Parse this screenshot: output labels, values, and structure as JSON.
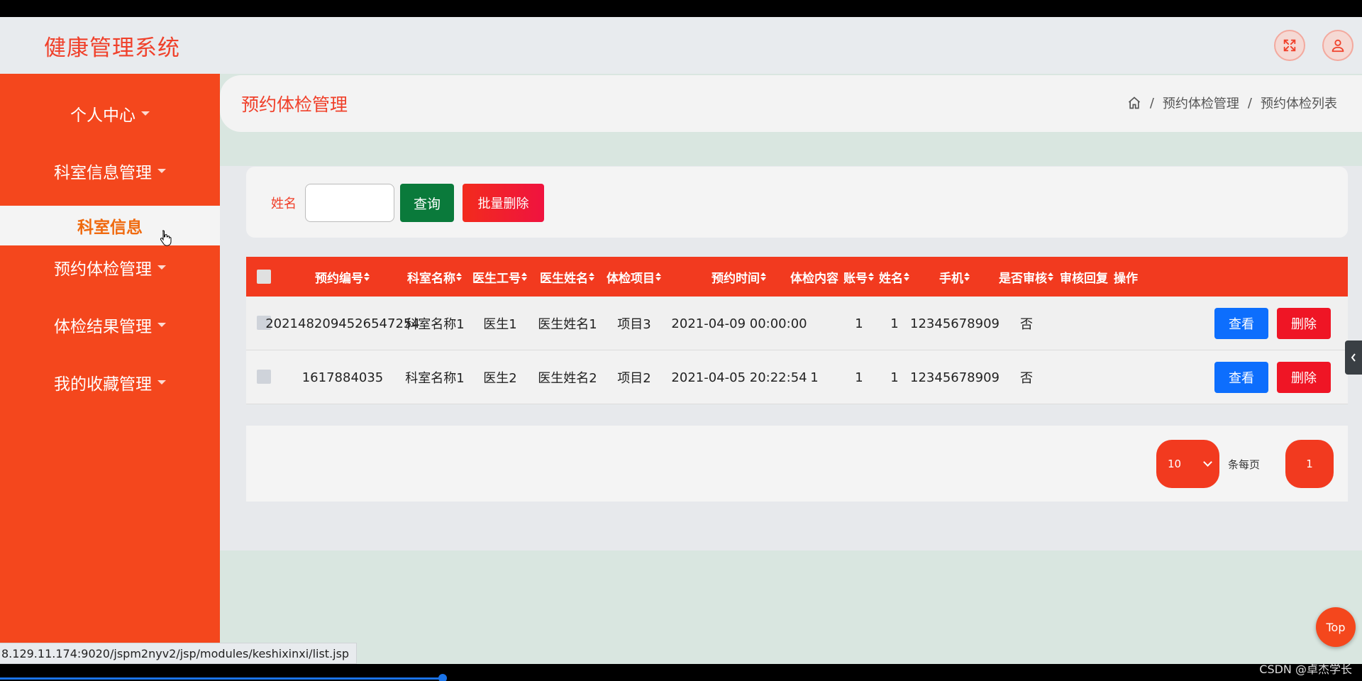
{
  "app": {
    "title": "健康管理系统"
  },
  "sidebar": {
    "items": [
      {
        "label": "个人中心"
      },
      {
        "label": "科室信息管理"
      },
      {
        "label": "预约体检管理"
      },
      {
        "label": "体检结果管理"
      },
      {
        "label": "我的收藏管理"
      }
    ],
    "active_sub": {
      "label": "科室信息"
    }
  },
  "page": {
    "title": "预约体检管理",
    "breadcrumb": [
      "预约体检管理",
      "预约体检列表"
    ],
    "separator": "/"
  },
  "search": {
    "label": "姓名",
    "value": "",
    "query_label": "查询",
    "batch_delete_label": "批量删除"
  },
  "table": {
    "columns": [
      "预约编号",
      "科室名称",
      "医生工号",
      "医生姓名",
      "体检项目",
      "预约时间",
      "体检内容",
      "账号",
      "姓名",
      "手机",
      "是否审核",
      "审核回复",
      "操作"
    ],
    "rows": [
      {
        "id": "2021482094526547254",
        "dept": "科室名称1",
        "doc_no": "医生1",
        "doc_name": "医生姓名1",
        "item": "项目3",
        "time": "2021-04-09 00:00:00",
        "content": "",
        "account": "1",
        "name": "1",
        "phone": "12345678909",
        "audited": "否",
        "reply": ""
      },
      {
        "id": "1617884035",
        "dept": "科室名称1",
        "doc_no": "医生2",
        "doc_name": "医生姓名2",
        "item": "项目2",
        "time": "2021-04-05 20:22:54",
        "content": "1",
        "account": "1",
        "name": "1",
        "phone": "12345678909",
        "audited": "否",
        "reply": ""
      }
    ],
    "view_label": "查看",
    "delete_label": "删除"
  },
  "pager": {
    "page_size": "10",
    "per_page_label": "条每页",
    "current_page": "1"
  },
  "top_button": "Top",
  "status_url": "8.129.11.174:9020/jspm2nyv2/jsp/modules/keshixinxi/list.jsp",
  "watermark": "CSDN @卓杰学长",
  "colors": {
    "brand": "#f4471d",
    "accent_red": "#f0402a",
    "query_green": "#0a7a3b",
    "view_blue": "#0d6efd",
    "delete_red": "#ef1525"
  }
}
